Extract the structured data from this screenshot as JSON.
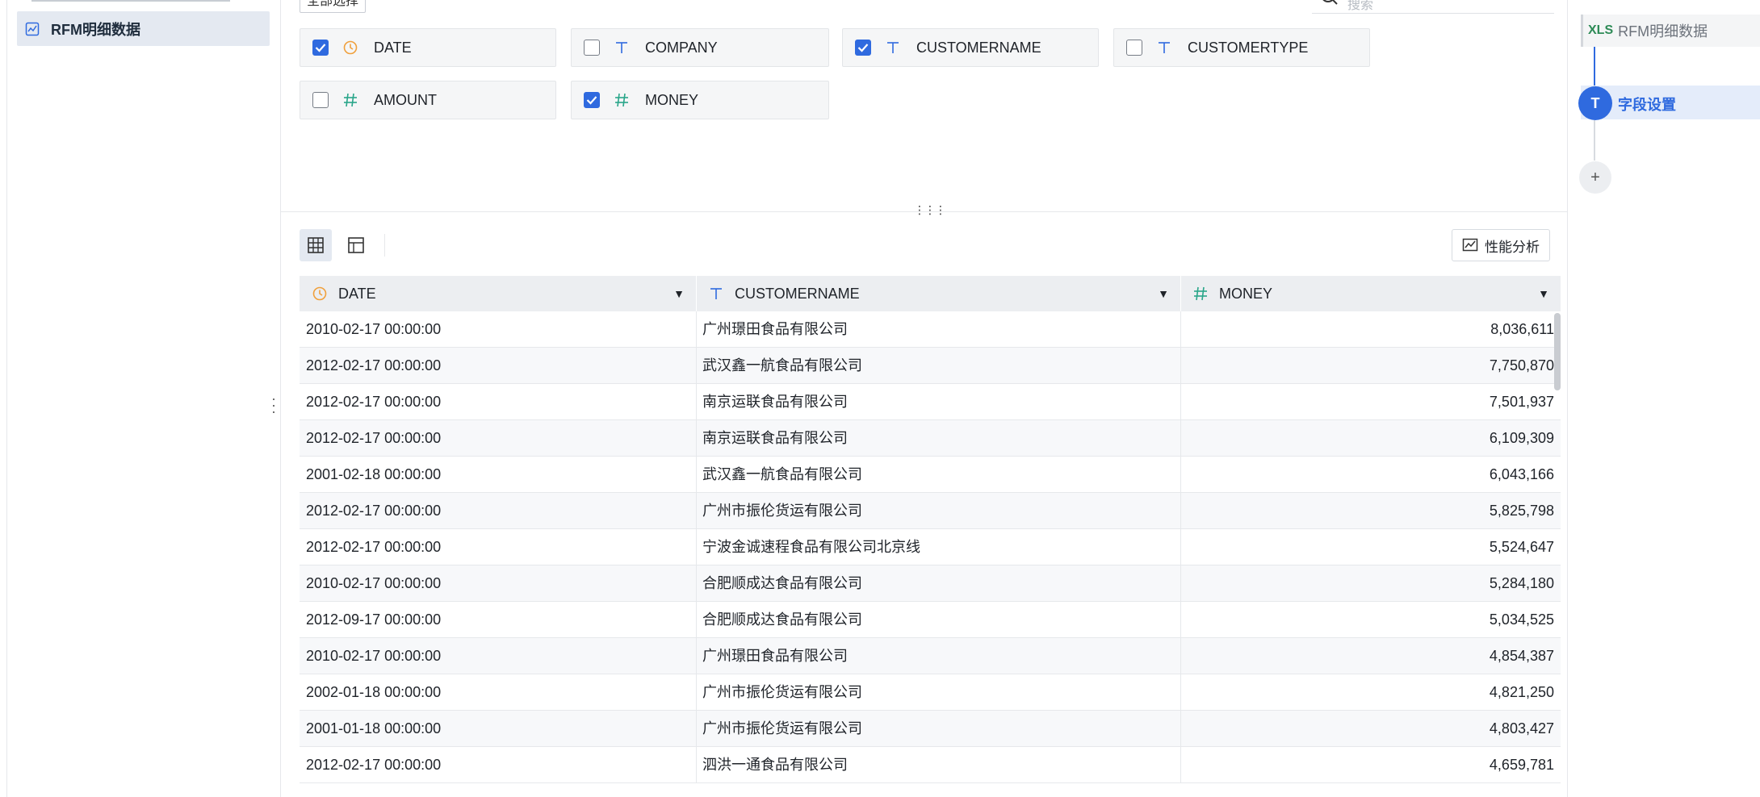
{
  "sidebar": {
    "items": [
      {
        "label": "RFM明细数据",
        "icon": "chart-line-icon"
      }
    ]
  },
  "fields_panel": {
    "select_all_label": "全部选择",
    "search_placeholder": "搜索",
    "fields": [
      {
        "name": "DATE",
        "type": "date",
        "checked": true
      },
      {
        "name": "COMPANY",
        "type": "text",
        "checked": false
      },
      {
        "name": "CUSTOMERNAME",
        "type": "text",
        "checked": true
      },
      {
        "name": "CUSTOMERTYPE",
        "type": "text",
        "checked": false
      },
      {
        "name": "AMOUNT",
        "type": "number",
        "checked": false
      },
      {
        "name": "MONEY",
        "type": "number",
        "checked": true
      }
    ]
  },
  "toolbar": {
    "perf_label": "性能分析"
  },
  "table": {
    "columns": [
      {
        "label": "DATE",
        "type": "date"
      },
      {
        "label": "CUSTOMERNAME",
        "type": "text"
      },
      {
        "label": "MONEY",
        "type": "number"
      }
    ],
    "rows": [
      [
        "2010-02-17 00:00:00",
        "广州璟田食品有限公司",
        "8,036,611"
      ],
      [
        "2012-02-17 00:00:00",
        "武汉鑫一航食品有限公司",
        "7,750,870"
      ],
      [
        "2012-02-17 00:00:00",
        "南京运联食品有限公司",
        "7,501,937"
      ],
      [
        "2012-02-17 00:00:00",
        "南京运联食品有限公司",
        "6,109,309"
      ],
      [
        "2001-02-18 00:00:00",
        "武汉鑫一航食品有限公司",
        "6,043,166"
      ],
      [
        "2012-02-17 00:00:00",
        "广州市振伦货运有限公司",
        "5,825,798"
      ],
      [
        "2012-02-17 00:00:00",
        "宁波金诚速程食品有限公司北京线",
        "5,524,647"
      ],
      [
        "2010-02-17 00:00:00",
        "合肥顺成达食品有限公司",
        "5,284,180"
      ],
      [
        "2012-09-17 00:00:00",
        "合肥顺成达食品有限公司",
        "5,034,525"
      ],
      [
        "2010-02-17 00:00:00",
        "广州璟田食品有限公司",
        "4,854,387"
      ],
      [
        "2002-01-18 00:00:00",
        "广州市振伦货运有限公司",
        "4,821,250"
      ],
      [
        "2001-01-18 00:00:00",
        "广州市振伦货运有限公司",
        "4,803,427"
      ],
      [
        "2012-02-17 00:00:00",
        "泗洪一通食品有限公司",
        "4,659,781"
      ]
    ]
  },
  "right_panel": {
    "source_label": "RFM明细数据",
    "source_badge": "XLS",
    "step_label": "字段设置",
    "step_icon_text": "T"
  },
  "colors": {
    "accent": "#2f6adf",
    "date_icon": "#f0a03c",
    "text_icon": "#2f6adf",
    "number_icon": "#2aa68a"
  }
}
